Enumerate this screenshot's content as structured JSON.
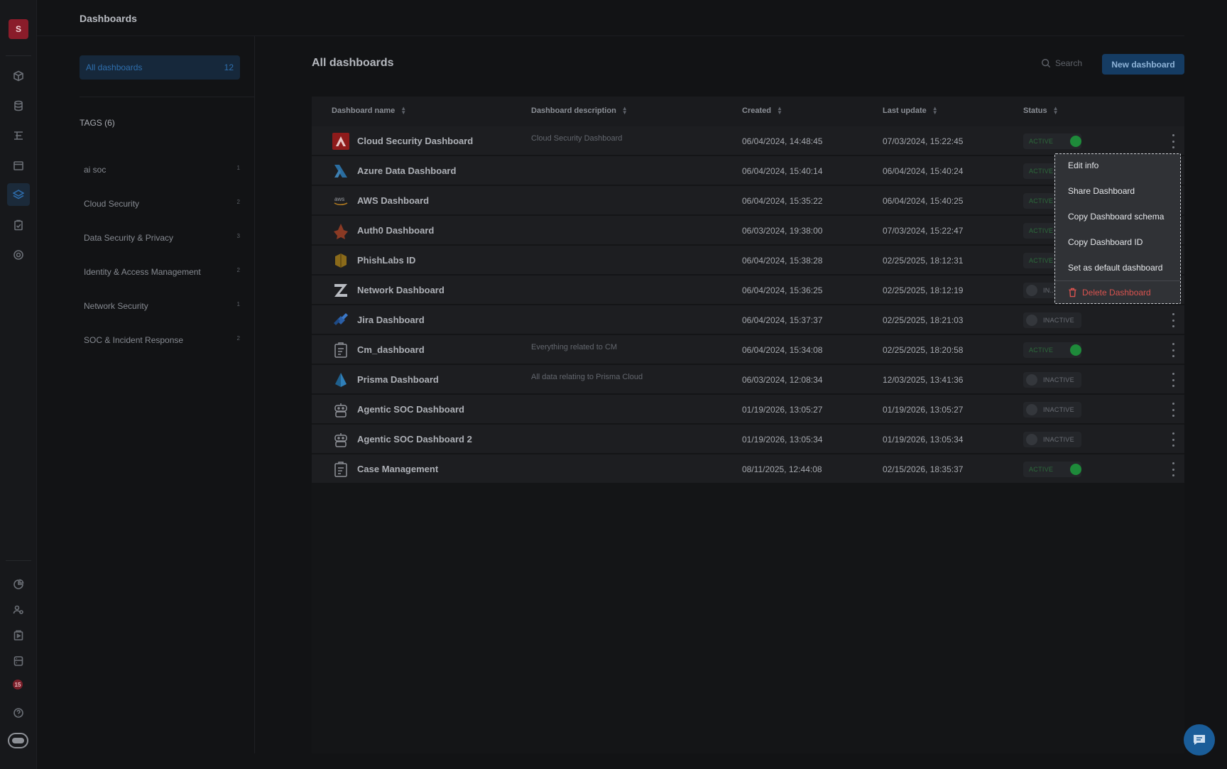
{
  "app": {
    "logo_letter": "S",
    "notification_count": "15"
  },
  "header": {
    "title": "Dashboards"
  },
  "sidebar": {
    "all_dashboards_label": "All dashboards",
    "all_dashboards_count": "12",
    "tags_title": "TAGS (6)",
    "tags": [
      {
        "label": "ai soc",
        "count": "1"
      },
      {
        "label": "Cloud Security",
        "count": "2"
      },
      {
        "label": "Data Security & Privacy",
        "count": "3"
      },
      {
        "label": "Identity & Access Management",
        "count": "2"
      },
      {
        "label": "Network Security",
        "count": "1"
      },
      {
        "label": "SOC & Incident Response",
        "count": "2"
      }
    ]
  },
  "main": {
    "title": "All dashboards",
    "search_placeholder": "Search",
    "new_button": "New dashboard",
    "columns": [
      "Dashboard name",
      "Dashboard description",
      "Created",
      "Last update",
      "Status"
    ],
    "status_labels": {
      "active": "ACTIVE",
      "inactive": "INACTIVE",
      "inactive_truncated": "IN..."
    },
    "rows": [
      {
        "icon": "adobe-icon",
        "name": "Cloud Security Dashboard",
        "description": "Cloud Security Dashboard",
        "created": "06/04/2024, 14:48:45",
        "updated": "07/03/2024, 15:22:45",
        "status": "active"
      },
      {
        "icon": "azure-icon",
        "name": "Azure Data Dashboard",
        "description": "",
        "created": "06/04/2024, 15:40:14",
        "updated": "06/04/2024, 15:40:24",
        "status": "active"
      },
      {
        "icon": "aws-icon",
        "name": "AWS Dashboard",
        "description": "",
        "created": "06/04/2024, 15:35:22",
        "updated": "06/04/2024, 15:40:25",
        "status": "active"
      },
      {
        "icon": "auth0-icon",
        "name": "Auth0 Dashboard",
        "description": "",
        "created": "06/03/2024, 19:38:00",
        "updated": "07/03/2024, 15:22:47",
        "status": "active"
      },
      {
        "icon": "phishlabs-icon",
        "name": "PhishLabs ID",
        "description": "",
        "created": "06/04/2024, 15:38:28",
        "updated": "02/25/2025, 18:12:31",
        "status": "active"
      },
      {
        "icon": "zscaler-icon",
        "name": "Network Dashboard",
        "description": "",
        "created": "06/04/2024, 15:36:25",
        "updated": "02/25/2025, 18:12:19",
        "status": "inactive"
      },
      {
        "icon": "jira-icon",
        "name": "Jira Dashboard",
        "description": "",
        "created": "06/04/2024, 15:37:37",
        "updated": "02/25/2025, 18:21:03",
        "status": "inactive"
      },
      {
        "icon": "clipboard-icon",
        "name": "Cm_dashboard",
        "description": "Everything related to CM",
        "created": "06/04/2024, 15:34:08",
        "updated": "02/25/2025, 18:20:58",
        "status": "active"
      },
      {
        "icon": "prisma-icon",
        "name": "Prisma Dashboard",
        "description": "All data relating to Prisma Cloud",
        "created": "06/03/2024, 12:08:34",
        "updated": "12/03/2025, 13:41:36",
        "status": "inactive"
      },
      {
        "icon": "robot-icon",
        "name": "Agentic SOC Dashboard",
        "description": "",
        "created": "01/19/2026, 13:05:27",
        "updated": "01/19/2026, 13:05:27",
        "status": "inactive"
      },
      {
        "icon": "robot-icon",
        "name": "Agentic SOC Dashboard 2",
        "description": "",
        "created": "01/19/2026, 13:05:34",
        "updated": "01/19/2026, 13:05:34",
        "status": "inactive"
      },
      {
        "icon": "clipboard-icon",
        "name": "Case Management",
        "description": "",
        "created": "08/11/2025, 12:44:08",
        "updated": "02/15/2026, 18:35:37",
        "status": "active"
      }
    ]
  },
  "context_menu": {
    "items": [
      "Edit info",
      "Share Dashboard",
      "Copy Dashboard schema",
      "Copy Dashboard ID",
      "Set as default dashboard"
    ],
    "delete_label": "Delete Dashboard"
  },
  "colors": {
    "accent": "#1a5d99",
    "active": "#1e8a3a",
    "danger": "#d9534f",
    "brand": "#8a1c2a"
  }
}
